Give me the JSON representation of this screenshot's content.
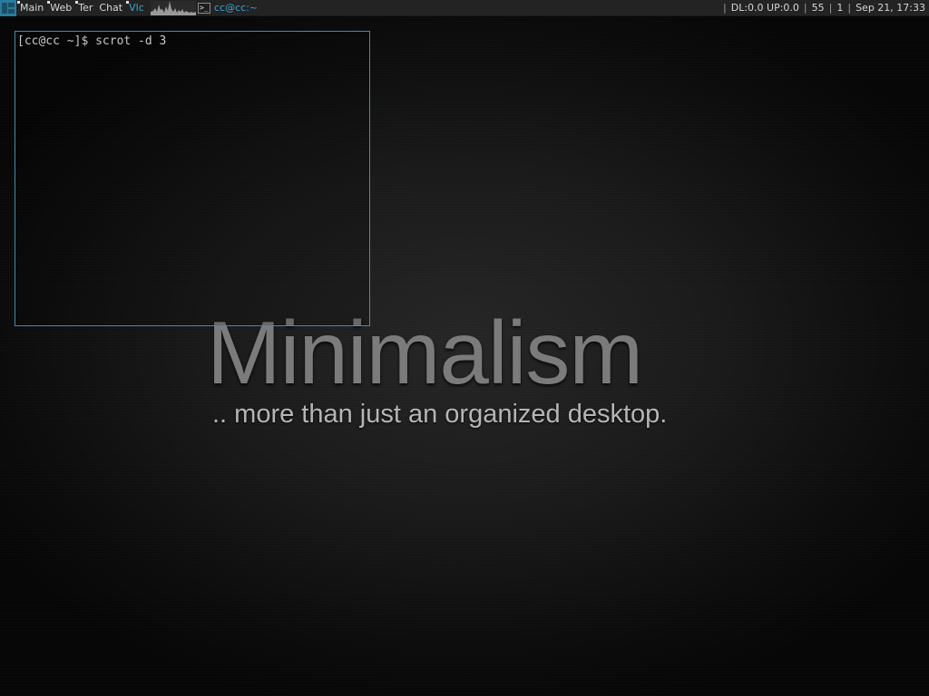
{
  "topbar": {
    "tags": [
      {
        "label": "Main",
        "has_clients": true,
        "active": false
      },
      {
        "label": "Web",
        "has_clients": true,
        "active": false
      },
      {
        "label": "Ter",
        "has_clients": true,
        "active": false
      },
      {
        "label": "Chat",
        "has_clients": false,
        "active": false
      },
      {
        "label": "Vlc",
        "has_clients": true,
        "active": true
      }
    ],
    "task": {
      "title": "cc@cc:~",
      "icon": "terminal-icon"
    },
    "status": {
      "network": "DL:0.0 UP:0.0",
      "value1": "55",
      "value2": "1",
      "datetime": "Sep 21, 17:33"
    },
    "colors": {
      "accent": "#3ba3d0",
      "bar": "#232323"
    }
  },
  "terminal": {
    "line": "[cc@cc ~]$ scrot -d 3"
  },
  "wallpaper": {
    "title": "Minimalism",
    "subtitle": ".. more than just an organized desktop."
  }
}
